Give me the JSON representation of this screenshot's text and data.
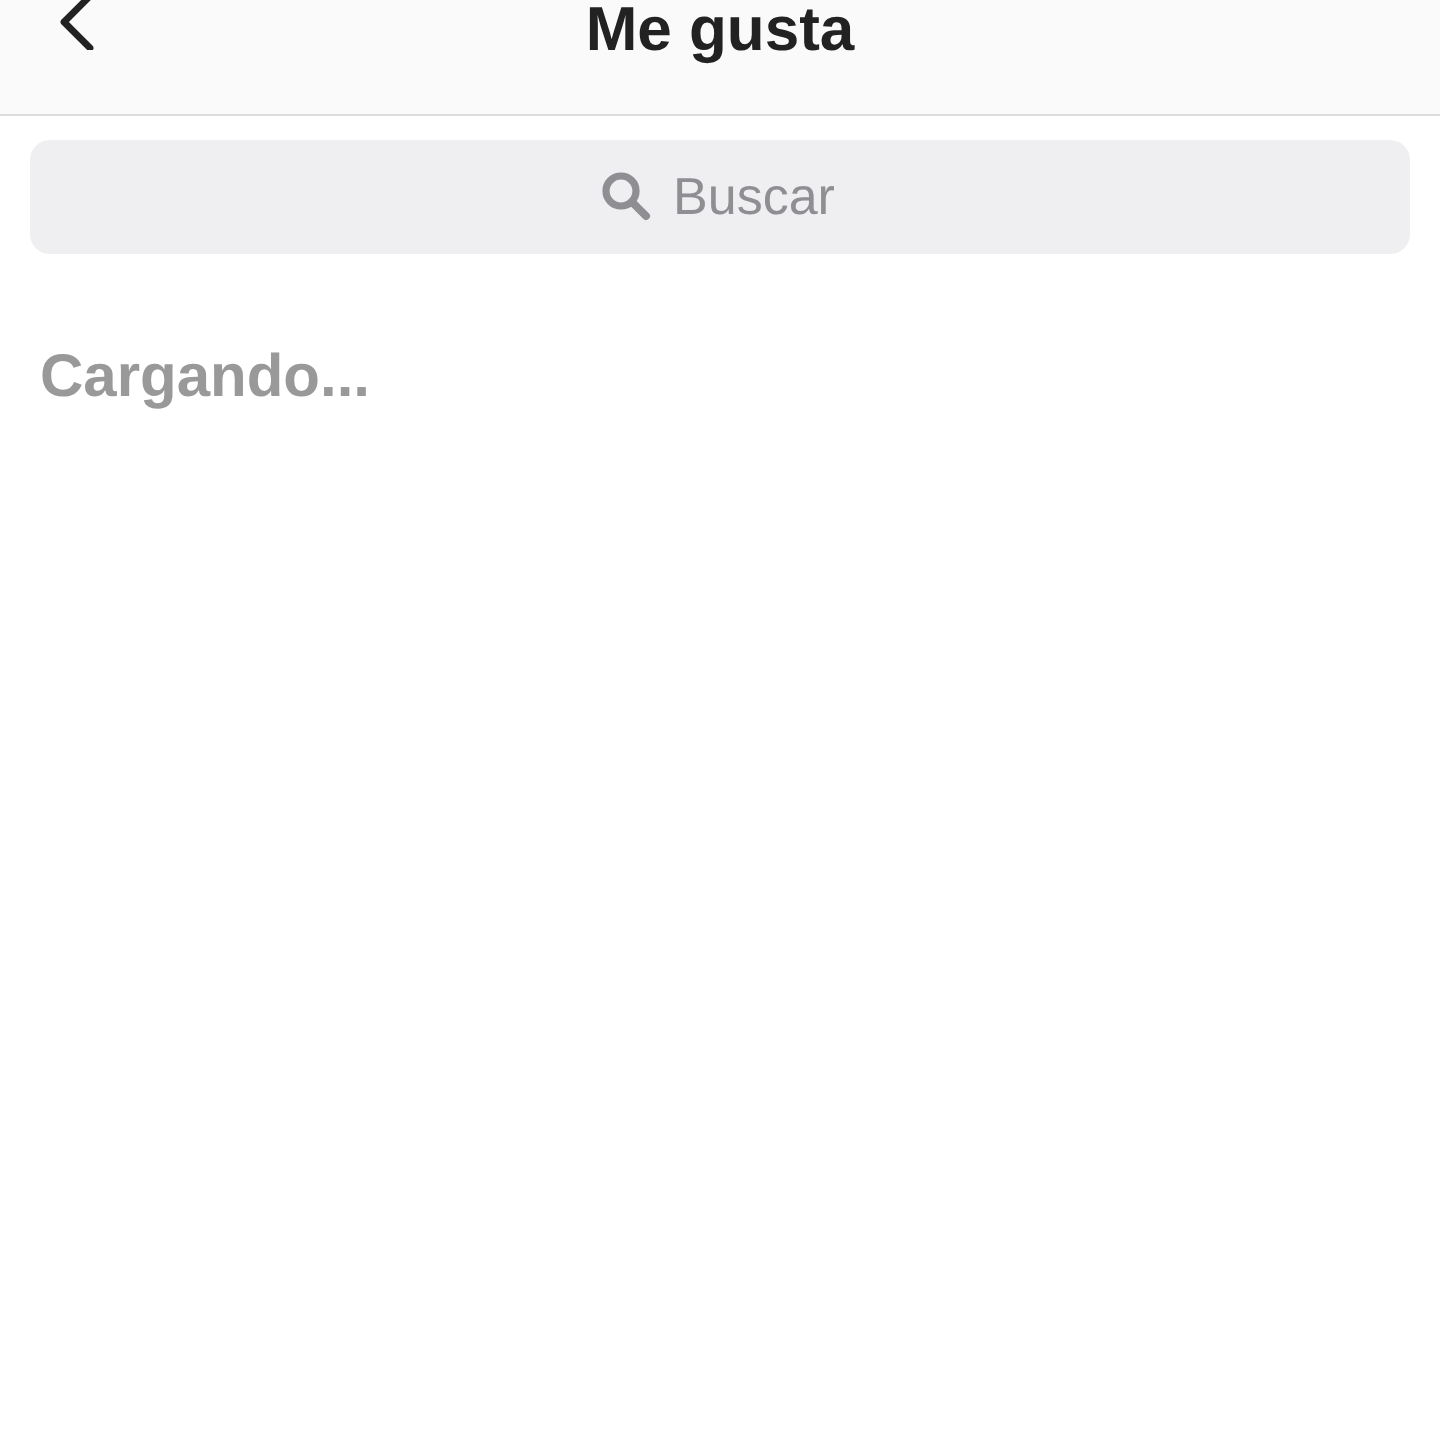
{
  "header": {
    "title": "Me gusta"
  },
  "search": {
    "placeholder": "Buscar"
  },
  "status": "Cargando..."
}
